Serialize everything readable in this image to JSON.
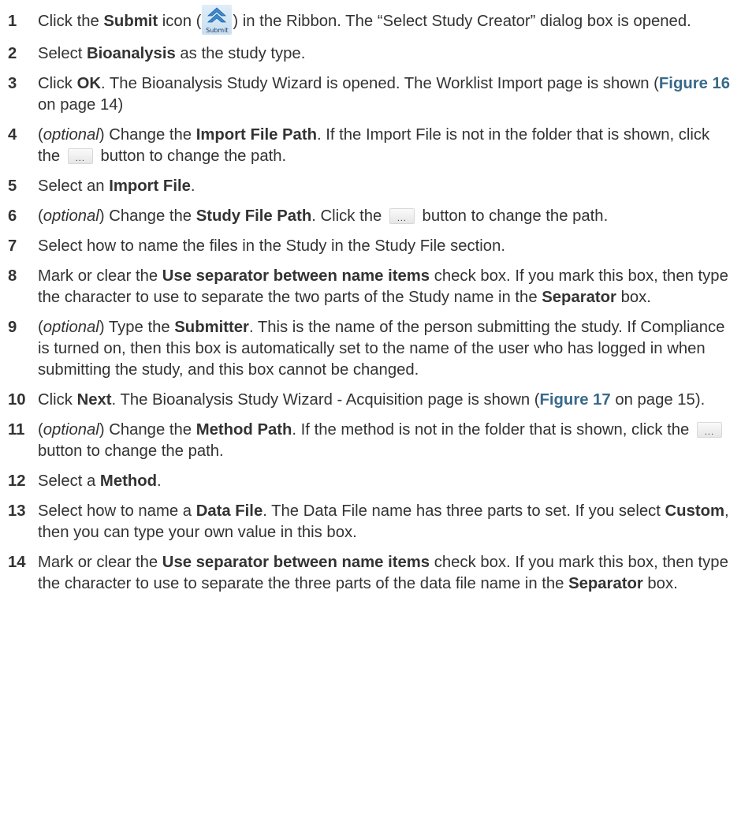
{
  "icons": {
    "submit_label": "Submit",
    "ellipsis": "..."
  },
  "steps": [
    {
      "num": "1",
      "t1": "Click the ",
      "b1": "Submit",
      "t2": " icon (",
      "t3": ") in the Ribbon. The “Select Study Creator” dialog box is opened."
    },
    {
      "num": "2",
      "t1": "Select ",
      "b1": "Bioanalysis",
      "t2": " as the study type."
    },
    {
      "num": "3",
      "t1": "Click ",
      "b1": "OK",
      "t2": ". The Bioanalysis Study Wizard is opened. The Worklist Import page is shown (",
      "link": "Figure 16",
      "t3": " on page 14)"
    },
    {
      "num": "4",
      "t1": "(",
      "i1": "optional",
      "t2": ") Change the ",
      "b1": "Import File Path",
      "t3": ". If the Import File is not in the folder that is shown, click the ",
      "t4": " button to change the path."
    },
    {
      "num": "5",
      "t1": "Select an ",
      "b1": "Import File",
      "t2": "."
    },
    {
      "num": "6",
      "t1": "(",
      "i1": "optional",
      "t2": ") Change the ",
      "b1": "Study File Path",
      "t3": ". Click the ",
      "t4": " button to change the path."
    },
    {
      "num": "7",
      "t1": "Select how to name the files in the Study in the Study File section."
    },
    {
      "num": "8",
      "t1": "Mark or clear the ",
      "b1": "Use separator between name items",
      "t2": " check box. If you mark this box, then type the character to use to separate the two parts of the Study name in the ",
      "b2": "Separator",
      "t3": " box."
    },
    {
      "num": "9",
      "t1": "(",
      "i1": "optional",
      "t2": ") Type the ",
      "b1": "Submitter",
      "t3": ". This is the name of the person submitting the study. If Compliance is turned on, then this box is automatically set to the name of the user who has logged in when submitting the study, and this box cannot be changed."
    },
    {
      "num": "10",
      "t1": "Click ",
      "b1": "Next",
      "t2": ". The Bioanalysis Study Wizard - Acquisition page is shown (",
      "link": "Figure 17",
      "t3": " on page 15)."
    },
    {
      "num": "11",
      "t1": "(",
      "i1": "optional",
      "t2": ") Change the ",
      "b1": "Method Path",
      "t3": ". If the method is not in the folder that is shown, click the ",
      "t4": " button to change the path."
    },
    {
      "num": "12",
      "t1": "Select a ",
      "b1": "Method",
      "t2": "."
    },
    {
      "num": "13",
      "t1": "Select how to name a ",
      "b1": "Data File",
      "t2": ". The Data File name has three parts to set. If you select ",
      "b2": "Custom",
      "t3": ", then you can type your own value in this box."
    },
    {
      "num": "14",
      "t1": "Mark or clear the ",
      "b1": "Use separator between name items",
      "t2": " check box. If you mark this box, then type the character to use to separate the three parts of the data file name in the ",
      "b2": "Separator",
      "t3": " box."
    }
  ]
}
